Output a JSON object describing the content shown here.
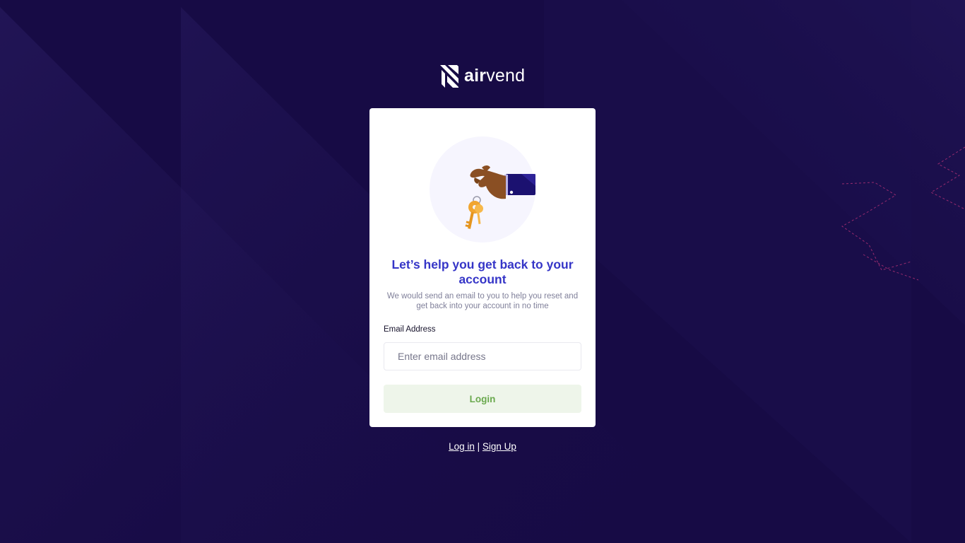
{
  "brand": {
    "name_prefix": "air",
    "name_suffix": "vend"
  },
  "card": {
    "title": "Let’s help you get back to your account",
    "subtitle": "We would send an email to you to help you reset and get back into your account in no time",
    "email_label": "Email Address",
    "email_placeholder": "Enter email address",
    "email_value": "",
    "submit_label": "Login"
  },
  "footer": {
    "login_link": "Log in",
    "separator": "|",
    "signup_link": "Sign Up"
  },
  "colors": {
    "background": "#170b45",
    "card": "#ffffff",
    "title": "#3535c7",
    "button_bg": "#eef5ea",
    "button_text": "#6aa94e"
  }
}
